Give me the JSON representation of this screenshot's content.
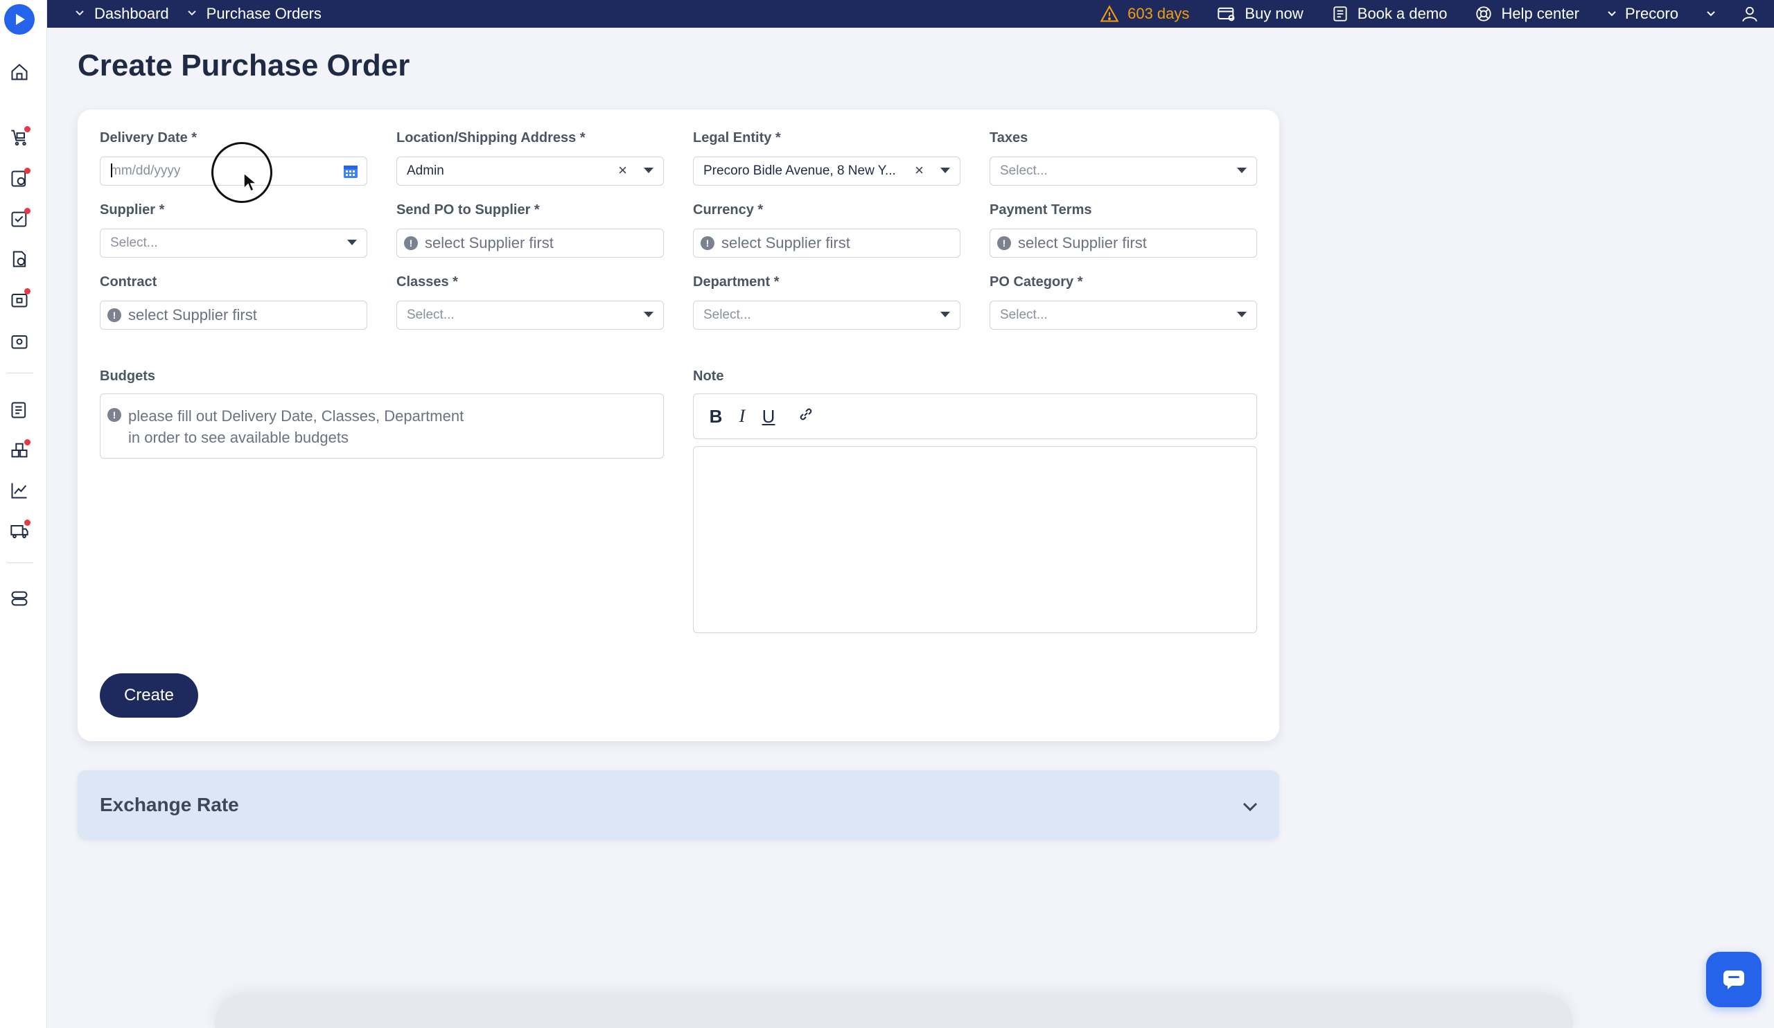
{
  "topbar": {
    "crumbs": [
      "Dashboard",
      "Purchase Orders"
    ],
    "trial": "603 days",
    "buy_now": "Buy now",
    "book_demo": "Book a demo",
    "help_center": "Help center",
    "company": "Precoro"
  },
  "page": {
    "title": "Create Purchase Order"
  },
  "form": {
    "delivery_date": {
      "label": "Delivery Date *",
      "placeholder": "mm/dd/yyyy"
    },
    "location": {
      "label": "Location/Shipping Address *",
      "value": "Admin"
    },
    "legal_entity": {
      "label": "Legal Entity *",
      "value": "Precoro Bidle Avenue, 8 New Y..."
    },
    "taxes": {
      "label": "Taxes",
      "placeholder": "Select..."
    },
    "supplier": {
      "label": "Supplier *",
      "placeholder": "Select..."
    },
    "send_po": {
      "label": "Send PO to Supplier *",
      "value": "select Supplier first"
    },
    "currency": {
      "label": "Currency *",
      "value": "select Supplier first"
    },
    "payment_terms": {
      "label": "Payment Terms",
      "value": "select Supplier first"
    },
    "contract": {
      "label": "Contract",
      "value": "select Supplier first"
    },
    "classes": {
      "label": "Classes *",
      "placeholder": "Select..."
    },
    "department": {
      "label": "Department *",
      "placeholder": "Select..."
    },
    "po_category": {
      "label": "PO Category *",
      "placeholder": "Select..."
    },
    "budgets": {
      "label": "Budgets",
      "line1": "please fill out Delivery Date, Classes, Department",
      "line2": "in order to see available budgets"
    },
    "note": {
      "label": "Note",
      "bold": "B",
      "italic": "I",
      "underline": "U"
    },
    "create": "Create"
  },
  "exchange": {
    "title": "Exchange Rate"
  },
  "colors": {
    "navy": "#1e2a5e",
    "accent": "#2563eb",
    "warning": "#f59e0b",
    "badge": "#e53945"
  }
}
